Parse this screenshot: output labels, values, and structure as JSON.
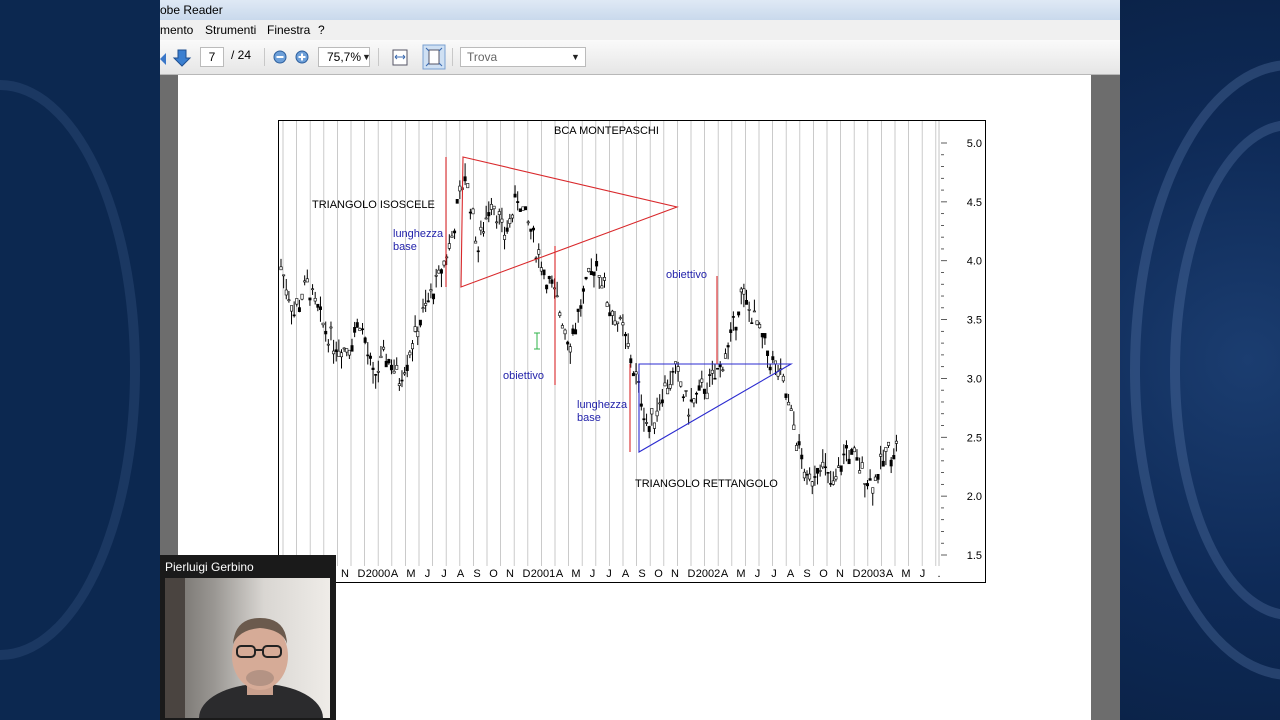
{
  "window": {
    "title": "obe Reader"
  },
  "menu": {
    "items": [
      "mento",
      "Strumenti",
      "Finestra",
      "?"
    ]
  },
  "toolbar": {
    "page_current": "7",
    "page_total": "/ 24",
    "zoom": "75,7%",
    "find_placeholder": "Trova"
  },
  "chart_data": {
    "type": "candlestick",
    "title": "BCA MONTEPASCHI",
    "yticks": [
      "5.0",
      "4.5",
      "4.0",
      "3.5",
      "3.0",
      "2.5",
      "2.0",
      "1.5"
    ],
    "ylim": [
      1.5,
      5.0
    ],
    "xticks": [
      "N",
      "D",
      "2000",
      "A",
      "M",
      "J",
      "J",
      "A",
      "S",
      "O",
      "N",
      "D",
      "2001",
      "A",
      "M",
      "J",
      "J",
      "A",
      "S",
      "O",
      "N",
      "D",
      "2002",
      "A",
      "M",
      "J",
      "J",
      "A",
      "S",
      "O",
      "N",
      "D",
      "2003",
      "A",
      "M",
      "J",
      "."
    ],
    "close_points": [
      {
        "t": 0,
        "v": 3.95
      },
      {
        "t": 1,
        "v": 3.55
      },
      {
        "t": 2,
        "v": 3.8
      },
      {
        "t": 3,
        "v": 3.5
      },
      {
        "t": 4,
        "v": 3.3
      },
      {
        "t": 5,
        "v": 3.25
      },
      {
        "t": 6,
        "v": 3.5
      },
      {
        "t": 7,
        "v": 3.0
      },
      {
        "t": 8,
        "v": 3.2
      },
      {
        "t": 9,
        "v": 3.0
      },
      {
        "t": 10,
        "v": 3.3
      },
      {
        "t": 11,
        "v": 3.6
      },
      {
        "t": 12,
        "v": 3.85
      },
      {
        "t": 13,
        "v": 4.2
      },
      {
        "t": 14,
        "v": 4.75
      },
      {
        "t": 15,
        "v": 4.1
      },
      {
        "t": 16,
        "v": 4.55
      },
      {
        "t": 17,
        "v": 4.2
      },
      {
        "t": 18,
        "v": 4.55
      },
      {
        "t": 19,
        "v": 4.25
      },
      {
        "t": 20,
        "v": 3.9
      },
      {
        "t": 21,
        "v": 3.65
      },
      {
        "t": 22,
        "v": 3.3
      },
      {
        "t": 23,
        "v": 3.7
      },
      {
        "t": 24,
        "v": 4.0
      },
      {
        "t": 25,
        "v": 3.6
      },
      {
        "t": 26,
        "v": 3.4
      },
      {
        "t": 27,
        "v": 3.0
      },
      {
        "t": 28,
        "v": 2.55
      },
      {
        "t": 29,
        "v": 2.9
      },
      {
        "t": 30,
        "v": 3.05
      },
      {
        "t": 31,
        "v": 2.75
      },
      {
        "t": 32,
        "v": 2.9
      },
      {
        "t": 33,
        "v": 3.0
      },
      {
        "t": 34,
        "v": 3.25
      },
      {
        "t": 35,
        "v": 3.7
      },
      {
        "t": 36,
        "v": 3.5
      },
      {
        "t": 37,
        "v": 3.2
      },
      {
        "t": 38,
        "v": 3.0
      },
      {
        "t": 39,
        "v": 2.6
      },
      {
        "t": 40,
        "v": 2.1
      },
      {
        "t": 41,
        "v": 2.3
      },
      {
        "t": 42,
        "v": 2.05
      },
      {
        "t": 43,
        "v": 2.4
      },
      {
        "t": 44,
        "v": 2.25
      },
      {
        "t": 45,
        "v": 2.1
      },
      {
        "t": 46,
        "v": 2.35
      },
      {
        "t": 47,
        "v": 2.45
      }
    ],
    "annotations": {
      "triangle1": "TRIANGOLO ISOSCELE",
      "base1": "lunghezza\nbase",
      "target1": "obiettivo",
      "target2": "obiettivo",
      "base2": "lunghezza\nbase",
      "triangle2": "TRIANGOLO RETTANGOLO"
    },
    "colors": {
      "red": "#d9282b",
      "blue": "#2b2bd0",
      "text": "#2222aa"
    }
  },
  "webcam": {
    "name": "Pierluigi Gerbino"
  }
}
